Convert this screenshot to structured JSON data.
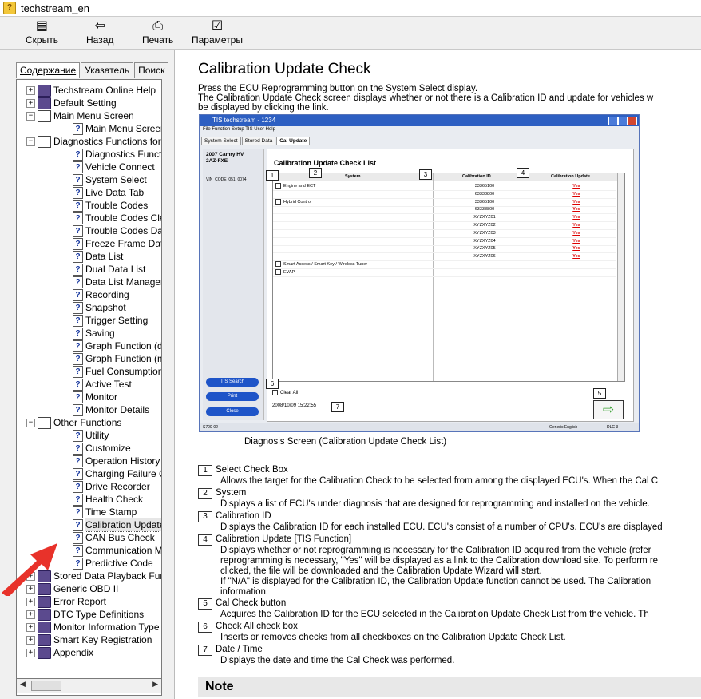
{
  "window": {
    "title": "techstream_en"
  },
  "toolbar": {
    "hide": "Скрыть",
    "back": "Назад",
    "print": "Печать",
    "options": "Параметры"
  },
  "tabs": {
    "contents": "Содержание",
    "index": "Указатель",
    "search": "Поиск"
  },
  "tree": [
    {
      "label": "Techstream Online Help",
      "level": 0,
      "type": "book",
      "exp": "+"
    },
    {
      "label": "Default Setting",
      "level": 0,
      "type": "book",
      "exp": "+"
    },
    {
      "label": "Main Menu Screen",
      "level": 0,
      "type": "openbook",
      "exp": "−"
    },
    {
      "label": "Main Menu Screen",
      "level": 1,
      "type": "page"
    },
    {
      "label": "Diagnostics Functions for To",
      "level": 0,
      "type": "openbook",
      "exp": "−"
    },
    {
      "label": "Diagnostics Functions fo",
      "level": 1,
      "type": "page"
    },
    {
      "label": "Vehicle Connect",
      "level": 1,
      "type": "page"
    },
    {
      "label": "System Select",
      "level": 1,
      "type": "page"
    },
    {
      "label": "Live Data Tab",
      "level": 1,
      "type": "page"
    },
    {
      "label": "Trouble Codes",
      "level": 1,
      "type": "page"
    },
    {
      "label": "Trouble Codes Clear",
      "level": 1,
      "type": "page"
    },
    {
      "label": "Trouble Codes Data Sto",
      "level": 1,
      "type": "page"
    },
    {
      "label": "Freeze Frame Data Disp",
      "level": 1,
      "type": "page"
    },
    {
      "label": "Data List",
      "level": 1,
      "type": "page"
    },
    {
      "label": "Dual Data List",
      "level": 1,
      "type": "page"
    },
    {
      "label": "Data List Manager",
      "level": 1,
      "type": "page"
    },
    {
      "label": "Recording",
      "level": 1,
      "type": "page"
    },
    {
      "label": "Snapshot",
      "level": 1,
      "type": "page"
    },
    {
      "label": "Trigger Setting",
      "level": 1,
      "type": "page"
    },
    {
      "label": "Saving",
      "level": 1,
      "type": "page"
    },
    {
      "label": "Graph Function (data m",
      "level": 1,
      "type": "page"
    },
    {
      "label": "Graph Function (multi fr",
      "level": 1,
      "type": "page"
    },
    {
      "label": "Fuel Consumption",
      "level": 1,
      "type": "page"
    },
    {
      "label": "Active Test",
      "level": 1,
      "type": "page"
    },
    {
      "label": "Monitor",
      "level": 1,
      "type": "page"
    },
    {
      "label": "Monitor Details",
      "level": 1,
      "type": "page"
    },
    {
      "label": "Other Functions",
      "level": 0,
      "type": "openbook",
      "exp": "−"
    },
    {
      "label": "Utility",
      "level": 1,
      "type": "page"
    },
    {
      "label": "Customize",
      "level": 1,
      "type": "page"
    },
    {
      "label": "Operation History",
      "level": 1,
      "type": "page"
    },
    {
      "label": "Charging Failure Causes",
      "level": 1,
      "type": "page"
    },
    {
      "label": "Drive Recorder",
      "level": 1,
      "type": "page"
    },
    {
      "label": "Health Check",
      "level": 1,
      "type": "page"
    },
    {
      "label": "Time Stamp",
      "level": 1,
      "type": "page"
    },
    {
      "label": "Calibration Update Chec",
      "level": 1,
      "type": "page",
      "selected": true
    },
    {
      "label": "CAN Bus Check",
      "level": 1,
      "type": "page"
    },
    {
      "label": "Communication Malfunc",
      "level": 1,
      "type": "page"
    },
    {
      "label": "Predictive Code",
      "level": 1,
      "type": "page"
    },
    {
      "label": "Stored Data Playback Func",
      "level": 0,
      "type": "book",
      "exp": "+"
    },
    {
      "label": "Generic OBD II",
      "level": 0,
      "type": "book",
      "exp": "+"
    },
    {
      "label": "Error Report",
      "level": 0,
      "type": "book",
      "exp": "+"
    },
    {
      "label": "DTC Type Definitions",
      "level": 0,
      "type": "book",
      "exp": "+"
    },
    {
      "label": "Monitor Information Type De",
      "level": 0,
      "type": "book",
      "exp": "+"
    },
    {
      "label": "Smart Key Registration",
      "level": 0,
      "type": "book",
      "exp": "+"
    },
    {
      "label": "Appendix",
      "level": 0,
      "type": "book",
      "exp": "+"
    }
  ],
  "page": {
    "title": "Calibration Update Check",
    "intro1": "Press the ECU Reprogramming button on the System Select display.",
    "intro2": "The Calibration Update Check screen displays whether or not there is a Calibration ID and update for vehicles w",
    "intro3": "be displayed by clicking the link.",
    "caption": "Diagnosis Screen (Calibration Update Check List)",
    "note": "Note"
  },
  "screenshot": {
    "title": "TIS techstream - 1234",
    "menu": "File   Function   Setup   TIS   User   Help",
    "tabs": [
      "System Select",
      "Stored Data",
      "Cal Update"
    ],
    "vehicle1": "2007 Camry HV",
    "vehicle2": "2AZ-FXE",
    "vin": "VIN_CODE_051_0074",
    "list_title": "Calibration Update Check List",
    "col_system": "System",
    "col_calid": "Calibration ID",
    "col_update": "Calibration Update",
    "rows": [
      {
        "system": "Engine and ECT",
        "calid": "33365100",
        "update": "Yes",
        "check": true
      },
      {
        "system": "",
        "calid": "63338800",
        "update": "Yes"
      },
      {
        "system": "Hybrid Control",
        "calid": "33365100",
        "update": "Yes",
        "check": true
      },
      {
        "system": "",
        "calid": "63338800",
        "update": "Yes"
      },
      {
        "system": "",
        "calid": "XYZXYZ01",
        "update": "Yes"
      },
      {
        "system": "",
        "calid": "XYZXYZ02",
        "update": "Yes"
      },
      {
        "system": "",
        "calid": "XYZXYZ03",
        "update": "Yes"
      },
      {
        "system": "",
        "calid": "XYZXYZ04",
        "update": "Yes"
      },
      {
        "system": "",
        "calid": "XYZXYZ05",
        "update": "Yes"
      },
      {
        "system": "",
        "calid": "XYZXYZ06",
        "update": "Yes"
      },
      {
        "system": "Smart Access / Smart Key / Wireless Tuner",
        "calid": "-",
        "update": "-",
        "check": true
      },
      {
        "system": "EVAP",
        "calid": "-",
        "update": "-",
        "check": true
      }
    ],
    "btn_tis": "TIS Search",
    "btn_print": "Print",
    "btn_close": "Close",
    "clear_all": "Clear All",
    "timestamp": "2008/10/09 15:22:55",
    "status_left": "S700-02",
    "status_mid": "Generic English",
    "status_right": "DLC 3"
  },
  "items": [
    {
      "n": "1",
      "title": "Select Check Box",
      "desc": [
        "Allows the target for the Calibration Check to be selected from among the displayed ECU's. When the Cal C"
      ]
    },
    {
      "n": "2",
      "title": "System",
      "desc": [
        "Displays a list of ECU's under diagnosis that are designed for reprogramming and installed on the vehicle."
      ]
    },
    {
      "n": "3",
      "title": "Calibration ID",
      "desc": [
        "Displays the Calibration ID for each installed ECU. ECU's consist of a number of CPU's. ECU's are displayed"
      ]
    },
    {
      "n": "4",
      "title": "Calibration Update  [TIS Function]",
      "desc": [
        "Displays whether or not reprogramming is necessary for the Calibration ID acquired from the vehicle (refer",
        "reprogramming is necessary, \"Yes\" will be displayed as a link to the Calibration download site. To perform re",
        "clicked, the file will be downloaded and the Calibration Update Wizard will start.",
        "If \"N/A\" is displayed for the Calibration ID, the Calibration Update function cannot be used. The Calibration",
        "information."
      ]
    },
    {
      "n": "5",
      "title": "Cal Check button",
      "desc": [
        "Acquires the Calibration ID for the ECU selected in the Calibration Update Check List from the vehicle. Th"
      ]
    },
    {
      "n": "6",
      "title": "Check All check box",
      "desc": [
        "Inserts or removes checks from all checkboxes on the Calibration Update Check List."
      ]
    },
    {
      "n": "7",
      "title": "Date / Time",
      "desc": [
        "Displays the date and time the Cal Check was performed."
      ]
    }
  ],
  "colors": {
    "accent_arrow": "#e8322a",
    "selected_bg": "#e6e6e6",
    "yes_link": "#dd0000"
  }
}
